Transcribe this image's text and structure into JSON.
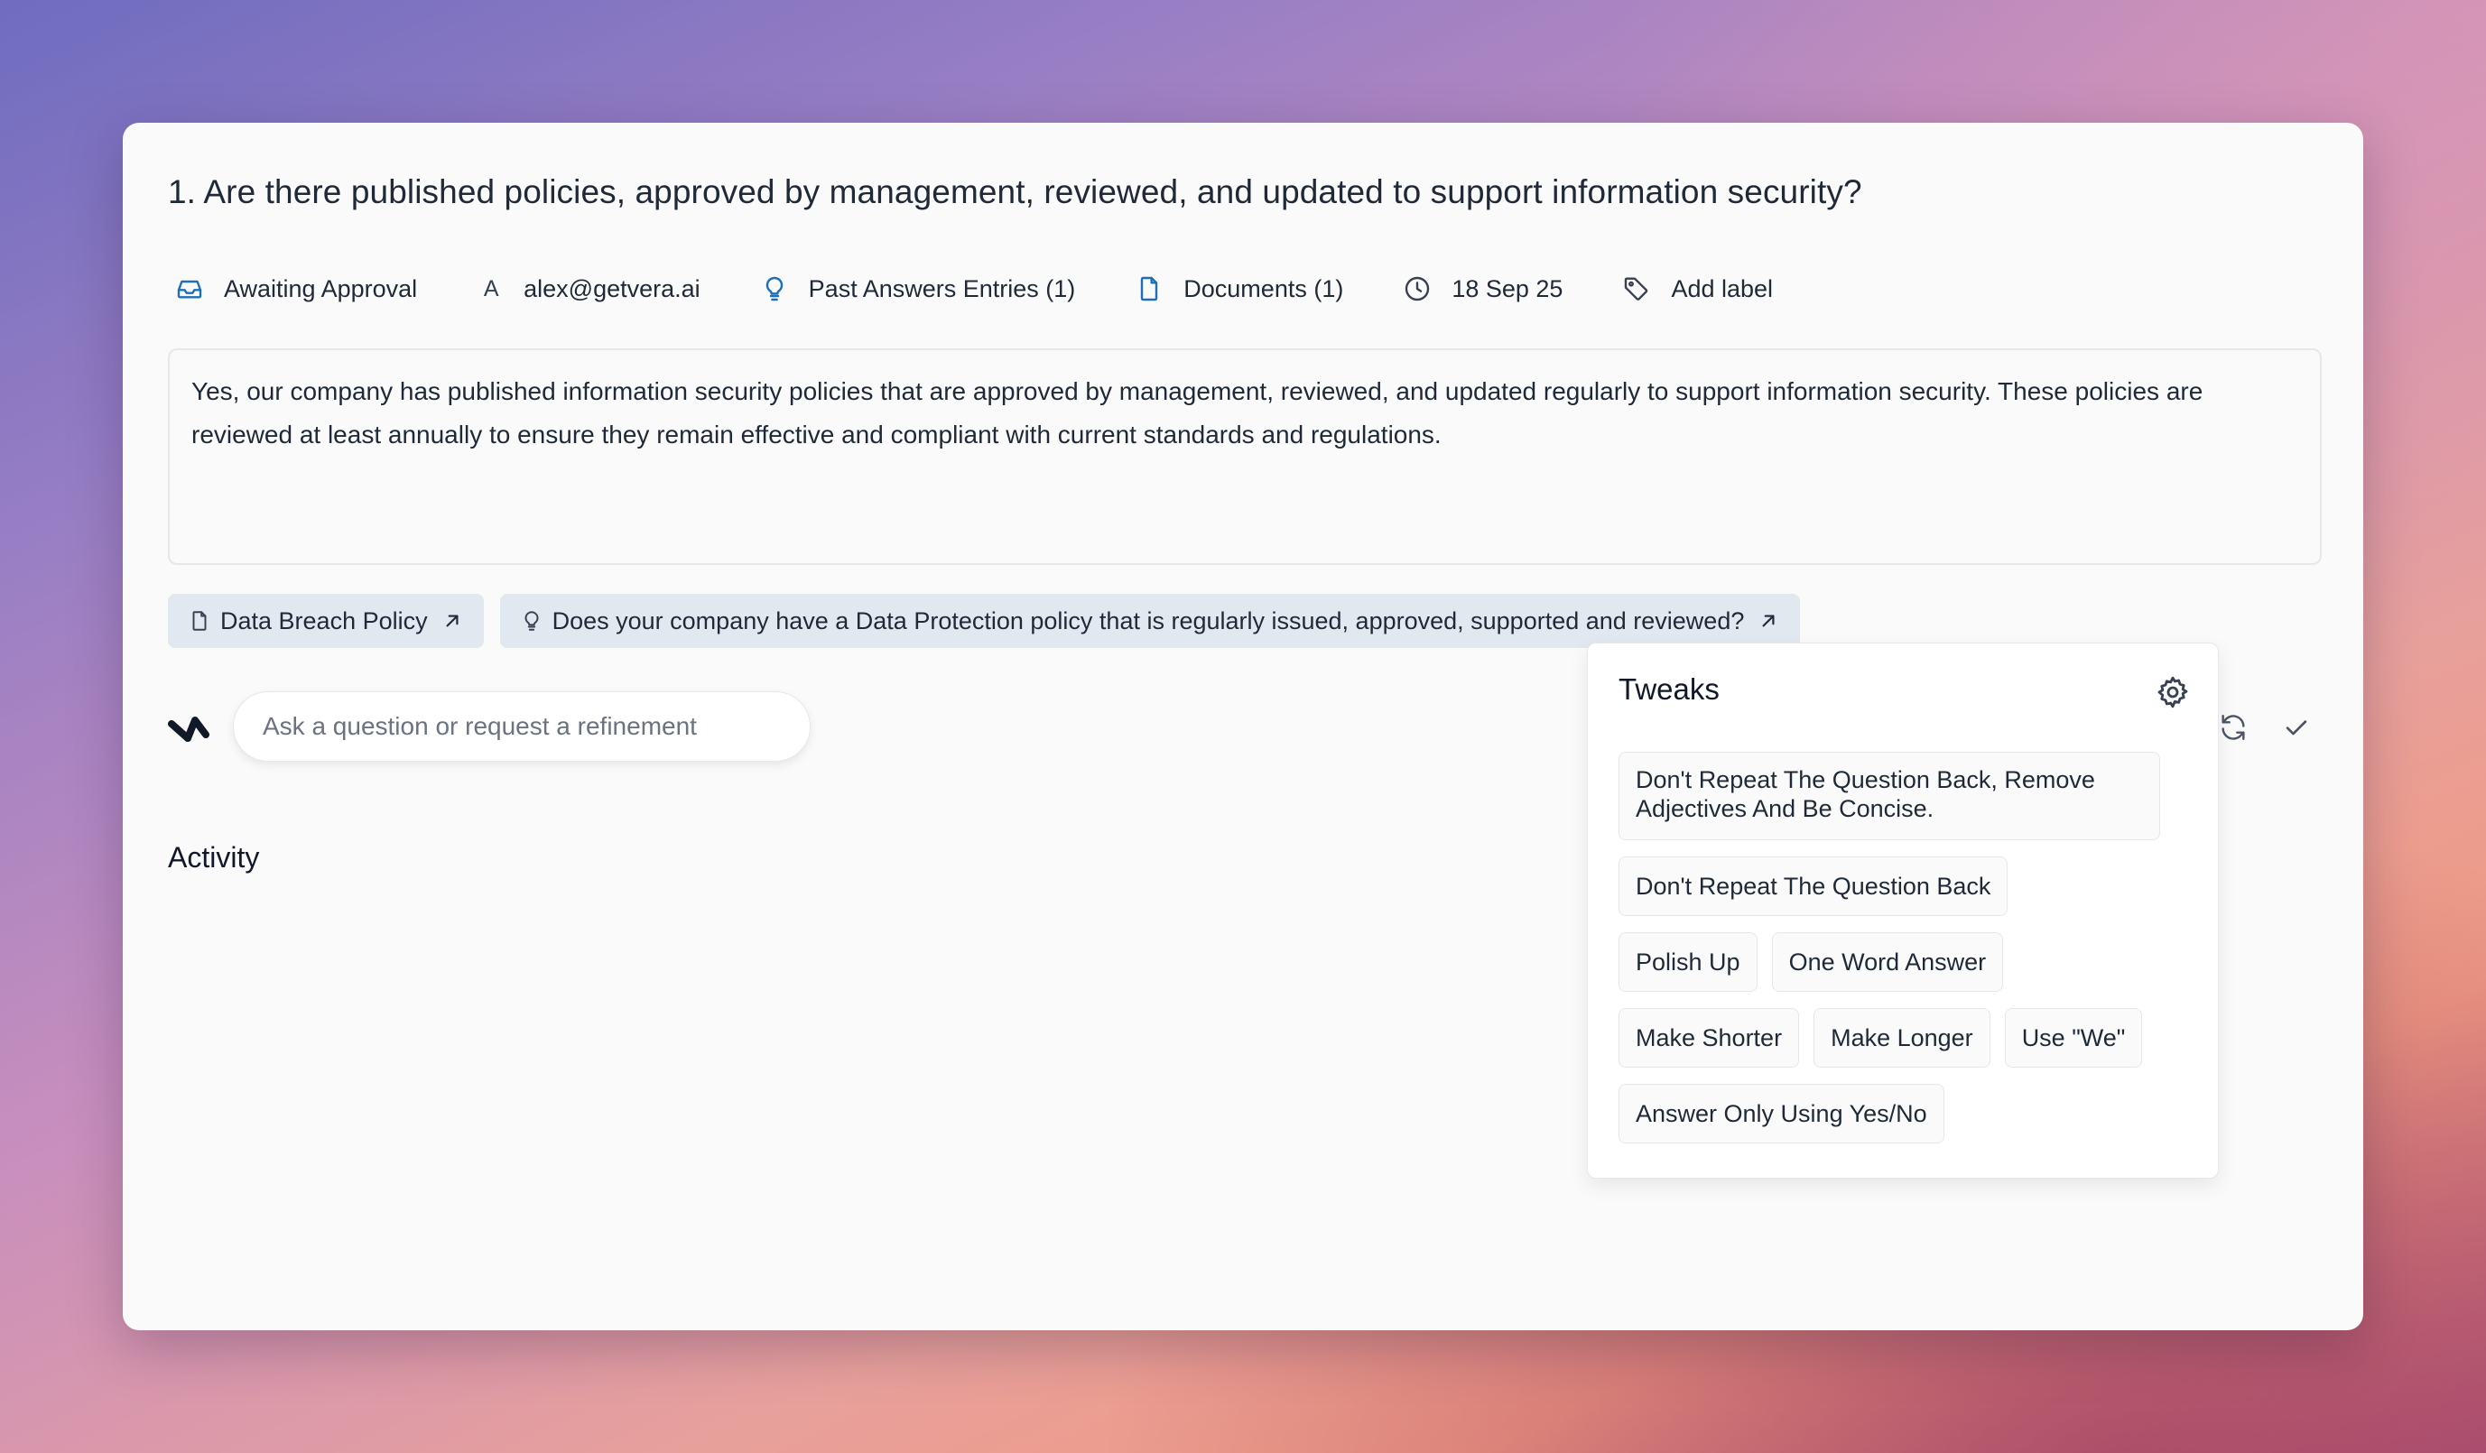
{
  "question": {
    "title": "1. Are there published policies, approved by management, reviewed, and updated to support information security?"
  },
  "meta": {
    "status": "Awaiting Approval",
    "assignee_initial": "A",
    "assignee": "alex@getvera.ai",
    "past_answers": "Past Answers Entries (1)",
    "documents": "Documents (1)",
    "date": "18 Sep 25",
    "add_label": "Add label"
  },
  "answer": {
    "text": "Yes, our company has published information security policies that are approved by management, reviewed, and updated regularly to support information security. These policies are reviewed at least annually to ensure they remain effective and compliant with current standards and regulations."
  },
  "sources": [
    {
      "label": "Data Breach Policy",
      "icon": "document-icon"
    },
    {
      "label": "Does your company have a Data Protection policy that is regularly issued, approved, supported and reviewed?",
      "icon": "lightbulb-icon"
    }
  ],
  "chat": {
    "placeholder": "Ask a question or request a refinement"
  },
  "activity": {
    "title": "Activity"
  },
  "tweaks": {
    "title": "Tweaks",
    "items": [
      "Don't Repeat The Question Back, Remove Adjectives And Be Concise.",
      "Don't Repeat The Question Back",
      "Polish Up",
      "One Word Answer",
      "Make Shorter",
      "Make Longer",
      "Use \"We\"",
      "Answer Only Using Yes/No"
    ]
  },
  "colors": {
    "accent": "#1e6fb8",
    "chip_bg": "#e2e8f0",
    "card_bg": "#fafafa"
  }
}
